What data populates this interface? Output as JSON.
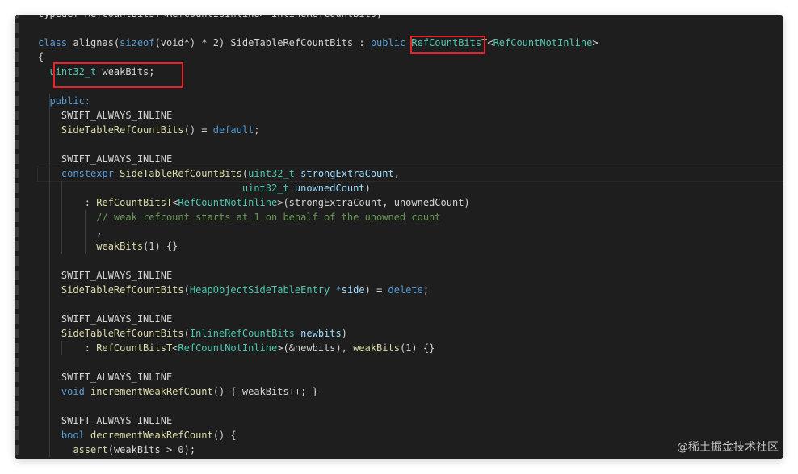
{
  "lines": [
    [
      [
        "plain",
        "typedef RefCountBitsT<RefCountIsInline> InlineRefCountBits;"
      ]
    ],
    [],
    [
      [
        "kw",
        "class "
      ],
      [
        "plain",
        "alignas("
      ],
      [
        "kw",
        "sizeof"
      ],
      [
        "plain",
        "(void*) * 2) SideTableRefCountBits : "
      ],
      [
        "kw",
        "public "
      ],
      [
        "ty",
        "RefCountBitsT"
      ],
      [
        "plain",
        "<"
      ],
      [
        "ty",
        "RefCountNotInline"
      ],
      [
        "plain",
        ">"
      ]
    ],
    [
      [
        "plain",
        "{"
      ]
    ],
    [
      [
        "plain",
        "  "
      ],
      [
        "ty",
        "uint32_t"
      ],
      [
        "plain",
        " weakBits;"
      ]
    ],
    [],
    [
      [
        "plain",
        "  "
      ],
      [
        "kw",
        "public:"
      ]
    ],
    [
      [
        "plain",
        "    SWIFT_ALWAYS_INLINE"
      ]
    ],
    [
      [
        "plain",
        "    "
      ],
      [
        "fn",
        "SideTableRefCountBits"
      ],
      [
        "plain",
        "() = "
      ],
      [
        "kw",
        "default"
      ],
      [
        "plain",
        ";"
      ]
    ],
    [],
    [
      [
        "plain",
        "    SWIFT_ALWAYS_INLINE"
      ]
    ],
    [
      [
        "plain",
        "    "
      ],
      [
        "kw",
        "constexpr "
      ],
      [
        "fn",
        "SideTableRefCountBits"
      ],
      [
        "plain",
        "("
      ],
      [
        "ty",
        "uint32_t "
      ],
      [
        "pm",
        "strongExtraCount"
      ],
      [
        "plain",
        ","
      ]
    ],
    [
      [
        "plain",
        "                                   "
      ],
      [
        "ty",
        "uint32_t "
      ],
      [
        "pm",
        "unownedCount"
      ],
      [
        "plain",
        ")"
      ]
    ],
    [
      [
        "plain",
        "        : "
      ],
      [
        "fn",
        "RefCountBitsT"
      ],
      [
        "plain",
        "<"
      ],
      [
        "ty",
        "RefCountNotInline"
      ],
      [
        "plain",
        ">(strongExtraCount, unownedCount)"
      ]
    ],
    [
      [
        "plain",
        "          "
      ],
      [
        "cm",
        "// weak refcount starts at 1 on behalf of the unowned count"
      ]
    ],
    [
      [
        "plain",
        "          ,"
      ]
    ],
    [
      [
        "plain",
        "          "
      ],
      [
        "fn",
        "weakBits"
      ],
      [
        "plain",
        "(1) {}"
      ]
    ],
    [],
    [
      [
        "plain",
        "    SWIFT_ALWAYS_INLINE"
      ]
    ],
    [
      [
        "plain",
        "    "
      ],
      [
        "fn",
        "SideTableRefCountBits"
      ],
      [
        "plain",
        "("
      ],
      [
        "ty",
        "HeapObjectSideTableEntry "
      ],
      [
        "kw",
        "*"
      ],
      [
        "pm",
        "side"
      ],
      [
        "plain",
        ") = "
      ],
      [
        "kw",
        "delete"
      ],
      [
        "plain",
        ";"
      ]
    ],
    [],
    [
      [
        "plain",
        "    SWIFT_ALWAYS_INLINE"
      ]
    ],
    [
      [
        "plain",
        "    "
      ],
      [
        "fn",
        "SideTableRefCountBits"
      ],
      [
        "plain",
        "("
      ],
      [
        "ty",
        "InlineRefCountBits "
      ],
      [
        "pm",
        "newbits"
      ],
      [
        "plain",
        ")"
      ]
    ],
    [
      [
        "plain",
        "        : "
      ],
      [
        "fn",
        "RefCountBitsT"
      ],
      [
        "plain",
        "<"
      ],
      [
        "ty",
        "RefCountNotInline"
      ],
      [
        "plain",
        ">(&newbits), "
      ],
      [
        "fn",
        "weakBits"
      ],
      [
        "plain",
        "(1) {}"
      ]
    ],
    [],
    [
      [
        "plain",
        "    SWIFT_ALWAYS_INLINE"
      ]
    ],
    [
      [
        "plain",
        "    "
      ],
      [
        "kw",
        "void "
      ],
      [
        "fn",
        "incrementWeakRefCount"
      ],
      [
        "plain",
        "() { weakBits++; }"
      ]
    ],
    [],
    [
      [
        "plain",
        "    SWIFT_ALWAYS_INLINE"
      ]
    ],
    [
      [
        "plain",
        "    "
      ],
      [
        "kw",
        "bool "
      ],
      [
        "fn",
        "decrementWeakRefCount"
      ],
      [
        "plain",
        "() {"
      ]
    ],
    [
      [
        "plain",
        "      "
      ],
      [
        "fn",
        "assert"
      ],
      [
        "plain",
        "(weakBits > 0);"
      ]
    ]
  ],
  "watermark": "@稀土掘金技术社区"
}
